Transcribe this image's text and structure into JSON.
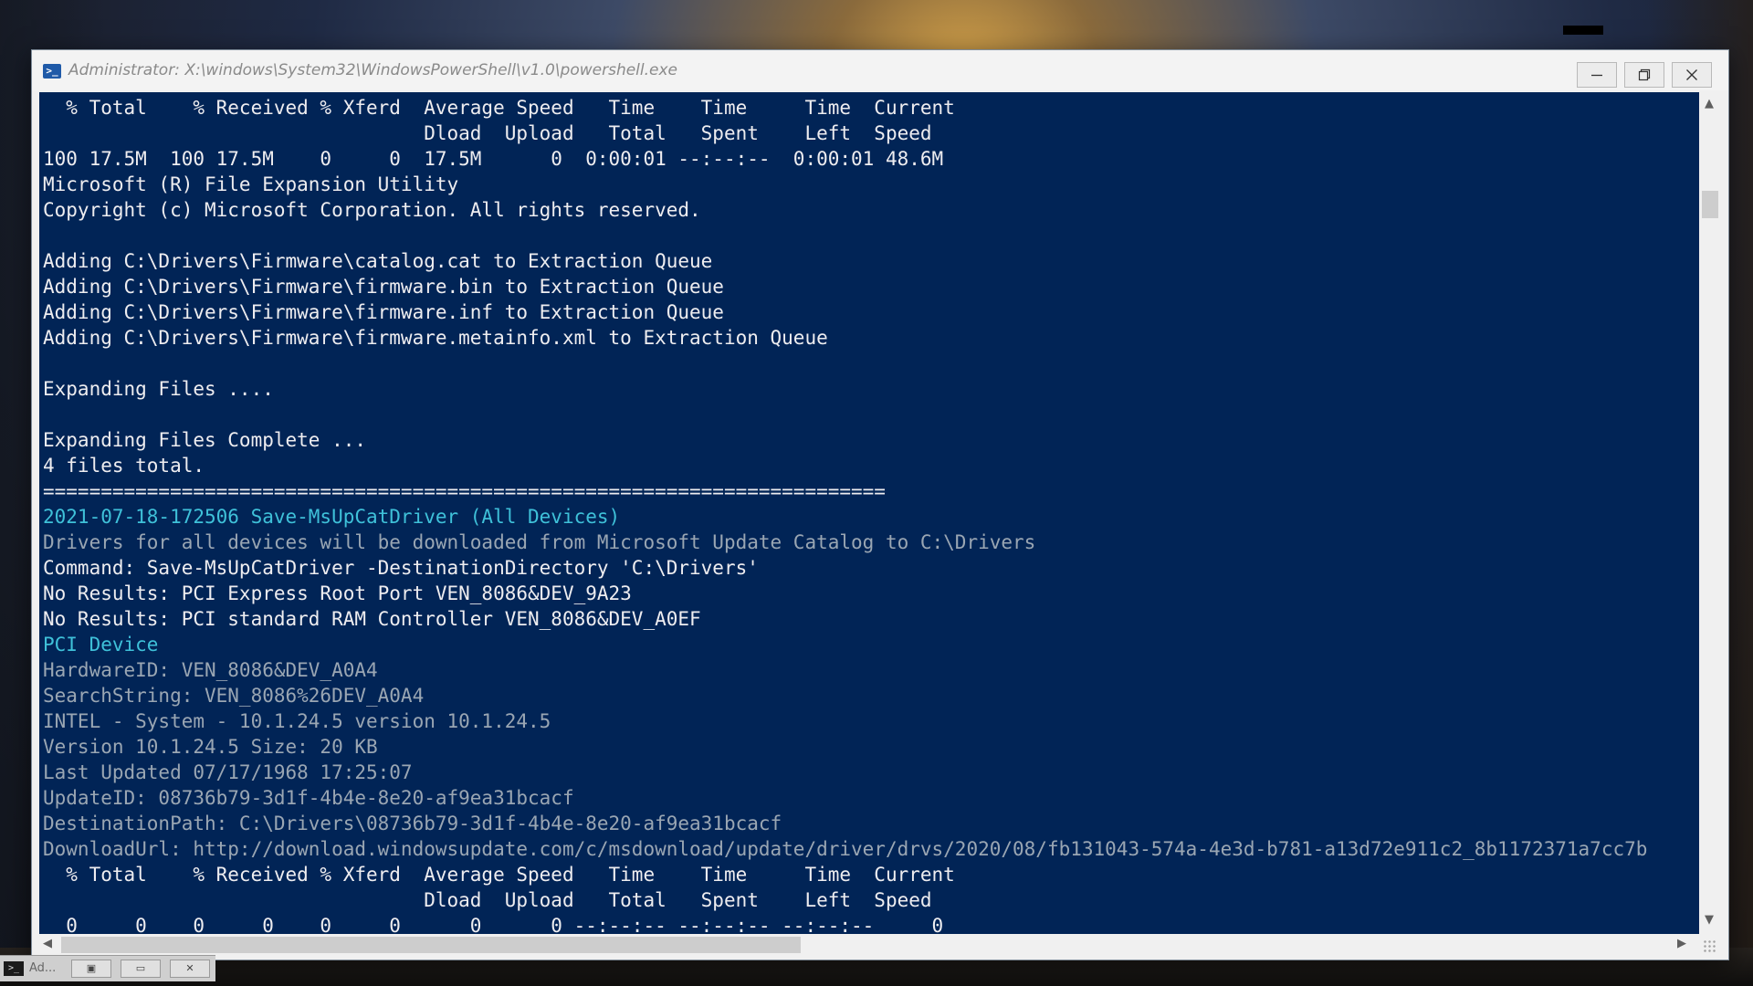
{
  "window": {
    "title": "Administrator: X:\\windows\\System32\\WindowsPowerShell\\v1.0\\powershell.exe",
    "icon": "powershell-icon",
    "buttons": {
      "minimize": "minimize-icon",
      "maximize": "maximize-icon",
      "close": "close-icon"
    }
  },
  "console": {
    "background": "#012456",
    "colors": {
      "default": "#eeedf0",
      "cyan": "#3fc1d9",
      "gray": "#9aa6b3"
    },
    "lines": [
      {
        "text": "  % Total    % Received % Xferd  Average Speed   Time    Time     Time  Current",
        "color": "default"
      },
      {
        "text": "                                 Dload  Upload   Total   Spent    Left  Speed",
        "color": "default"
      },
      {
        "text": "100 17.5M  100 17.5M    0     0  17.5M      0  0:00:01 --:--:--  0:00:01 48.6M",
        "color": "default"
      },
      {
        "text": "Microsoft (R) File Expansion Utility",
        "color": "default"
      },
      {
        "text": "Copyright (c) Microsoft Corporation. All rights reserved.",
        "color": "default"
      },
      {
        "text": "",
        "color": "default"
      },
      {
        "text": "Adding C:\\Drivers\\Firmware\\catalog.cat to Extraction Queue",
        "color": "default"
      },
      {
        "text": "Adding C:\\Drivers\\Firmware\\firmware.bin to Extraction Queue",
        "color": "default"
      },
      {
        "text": "Adding C:\\Drivers\\Firmware\\firmware.inf to Extraction Queue",
        "color": "default"
      },
      {
        "text": "Adding C:\\Drivers\\Firmware\\firmware.metainfo.xml to Extraction Queue",
        "color": "default"
      },
      {
        "text": "",
        "color": "default"
      },
      {
        "text": "Expanding Files ....",
        "color": "default"
      },
      {
        "text": "",
        "color": "default"
      },
      {
        "text": "Expanding Files Complete ...",
        "color": "default"
      },
      {
        "text": "4 files total.",
        "color": "default"
      },
      {
        "text": "=========================================================================",
        "color": "default"
      },
      {
        "text": "2021-07-18-172506 Save-MsUpCatDriver (All Devices)",
        "color": "cyan"
      },
      {
        "text": "Drivers for all devices will be downloaded from Microsoft Update Catalog to C:\\Drivers",
        "color": "gray"
      },
      {
        "text": "Command: Save-MsUpCatDriver -DestinationDirectory 'C:\\Drivers'",
        "color": "default"
      },
      {
        "text": "No Results: PCI Express Root Port VEN_8086&DEV_9A23",
        "color": "default"
      },
      {
        "text": "No Results: PCI standard RAM Controller VEN_8086&DEV_A0EF",
        "color": "default"
      },
      {
        "text": "PCI Device",
        "color": "cyan"
      },
      {
        "text": "HardwareID: VEN_8086&DEV_A0A4",
        "color": "gray"
      },
      {
        "text": "SearchString: VEN_8086%26DEV_A0A4",
        "color": "gray"
      },
      {
        "text": "INTEL - System - 10.1.24.5 version 10.1.24.5",
        "color": "gray"
      },
      {
        "text": "Version 10.1.24.5 Size: 20 KB",
        "color": "gray"
      },
      {
        "text": "Last Updated 07/17/1968 17:25:07",
        "color": "gray"
      },
      {
        "text": "UpdateID: 08736b79-3d1f-4b4e-8e20-af9ea31bcacf",
        "color": "gray"
      },
      {
        "text": "DestinationPath: C:\\Drivers\\08736b79-3d1f-4b4e-8e20-af9ea31bcacf",
        "color": "gray"
      },
      {
        "text": "DownloadUrl: http://download.windowsupdate.com/c/msdownload/update/driver/drvs/2020/08/fb131043-574a-4e3d-b781-a13d72e911c2_8b1172371a7cc7b",
        "color": "gray"
      },
      {
        "text": "  % Total    % Received % Xferd  Average Speed   Time    Time     Time  Current",
        "color": "default"
      },
      {
        "text": "                                 Dload  Upload   Total   Spent    Left  Speed",
        "color": "default"
      },
      {
        "text": "  0     0    0     0    0     0      0      0 --:--:-- --:--:-- --:--:--     0",
        "color": "default"
      }
    ]
  },
  "scrollbars": {
    "up": "▲",
    "down": "▼",
    "left": "◀",
    "right": "▶"
  },
  "minimized_window": {
    "label": "Ad...",
    "icon": "console-icon",
    "buttons": [
      "▣",
      "▭",
      "✕"
    ]
  }
}
